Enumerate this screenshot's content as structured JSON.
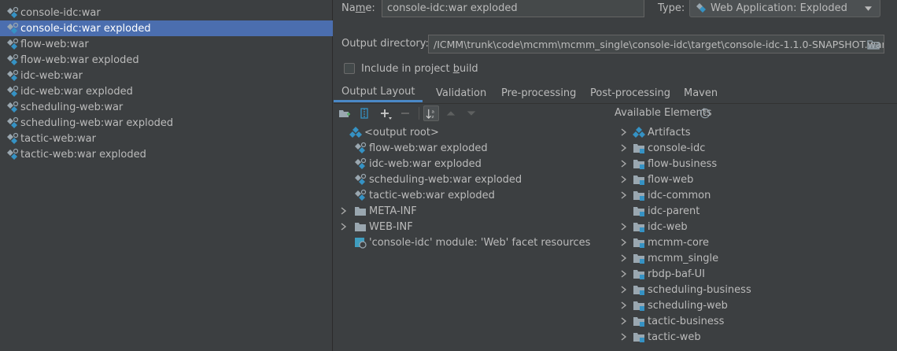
{
  "artifacts": [
    {
      "label": "console-idc:war",
      "icon": "war-artifact-icon"
    },
    {
      "label": "console-idc:war exploded",
      "icon": "war-exploded-artifact-icon",
      "selected": true
    },
    {
      "label": "flow-web:war",
      "icon": "war-artifact-icon"
    },
    {
      "label": "flow-web:war exploded",
      "icon": "war-exploded-artifact-icon"
    },
    {
      "label": "idc-web:war",
      "icon": "war-artifact-icon"
    },
    {
      "label": "idc-web:war exploded",
      "icon": "war-exploded-artifact-icon"
    },
    {
      "label": "scheduling-web:war",
      "icon": "war-artifact-icon"
    },
    {
      "label": "scheduling-web:war exploded",
      "icon": "war-exploded-artifact-icon"
    },
    {
      "label": "tactic-web:war",
      "icon": "war-artifact-icon"
    },
    {
      "label": "tactic-web:war exploded",
      "icon": "war-exploded-artifact-icon"
    }
  ],
  "form": {
    "name_label_pre": "Na",
    "name_label_mn": "m",
    "name_label_post": "e:",
    "name_value": "console-idc:war exploded",
    "type_label": "Type:",
    "type_value": "Web Application: Exploded",
    "output_dir_label": "Output directory:",
    "output_dir_value": "/ICMM\\trunk\\code\\mcmm\\mcmm_single\\console-idc\\target\\console-idc-1.1.0-SNAPSHOT.war",
    "include_label_pre": "Include in project ",
    "include_label_mn": "b",
    "include_label_post": "uild",
    "include_checked": false
  },
  "tabs": [
    {
      "label": "Output Layout",
      "active": true
    },
    {
      "label": "Validation"
    },
    {
      "label": "Pre-processing"
    },
    {
      "label": "Post-processing"
    },
    {
      "label": "Maven"
    }
  ],
  "toolbar": {
    "icons": [
      "create-directory-icon",
      "create-archive-icon",
      "add-icon",
      "remove-icon",
      "sort-icon",
      "move-up-icon",
      "move-down-icon"
    ]
  },
  "output_tree": [
    {
      "label": "<output root>",
      "icon": "output-root-icon",
      "level": 0,
      "expandable": false
    },
    {
      "label": "flow-web:war exploded",
      "icon": "war-exploded-artifact-icon",
      "level": 1,
      "expandable": false
    },
    {
      "label": "idc-web:war exploded",
      "icon": "war-exploded-artifact-icon",
      "level": 1,
      "expandable": false
    },
    {
      "label": "scheduling-web:war exploded",
      "icon": "war-exploded-artifact-icon",
      "level": 1,
      "expandable": false
    },
    {
      "label": "tactic-web:war exploded",
      "icon": "war-exploded-artifact-icon",
      "level": 1,
      "expandable": false
    },
    {
      "label": "META-INF",
      "icon": "folder-icon",
      "level": 1,
      "expandable": true
    },
    {
      "label": "WEB-INF",
      "icon": "folder-icon",
      "level": 1,
      "expandable": true
    },
    {
      "label": "'console-idc' module: 'Web' facet resources",
      "icon": "web-facet-icon",
      "level": 1,
      "expandable": false
    }
  ],
  "available": {
    "header": "Available Elements",
    "help_icon": "help-icon",
    "items": [
      {
        "label": "Artifacts",
        "icon": "artifacts-icon",
        "expandable": true
      },
      {
        "label": "console-idc",
        "icon": "module-folder-icon",
        "expandable": true
      },
      {
        "label": "flow-business",
        "icon": "module-folder-icon",
        "expandable": true
      },
      {
        "label": "flow-web",
        "icon": "module-folder-icon",
        "expandable": true
      },
      {
        "label": "idc-common",
        "icon": "module-folder-icon",
        "expandable": true
      },
      {
        "label": "idc-parent",
        "icon": "module-folder-icon",
        "expandable": false
      },
      {
        "label": "idc-web",
        "icon": "module-folder-icon",
        "expandable": true
      },
      {
        "label": "mcmm-core",
        "icon": "module-folder-icon",
        "expandable": true
      },
      {
        "label": "mcmm_single",
        "icon": "module-folder-icon",
        "expandable": true
      },
      {
        "label": "rbdp-baf-UI",
        "icon": "module-folder-icon",
        "expandable": true
      },
      {
        "label": "scheduling-business",
        "icon": "module-folder-icon",
        "expandable": true
      },
      {
        "label": "scheduling-web",
        "icon": "module-folder-icon",
        "expandable": true
      },
      {
        "label": "tactic-business",
        "icon": "module-folder-icon",
        "expandable": true
      },
      {
        "label": "tactic-web",
        "icon": "module-folder-icon",
        "expandable": true
      }
    ]
  },
  "colors": {
    "background": "#3c3f41",
    "selection": "#4b6eaf",
    "text": "#bbbbbb",
    "accent_blue": "#3592c4",
    "folder_gray": "#9aa7b0"
  }
}
